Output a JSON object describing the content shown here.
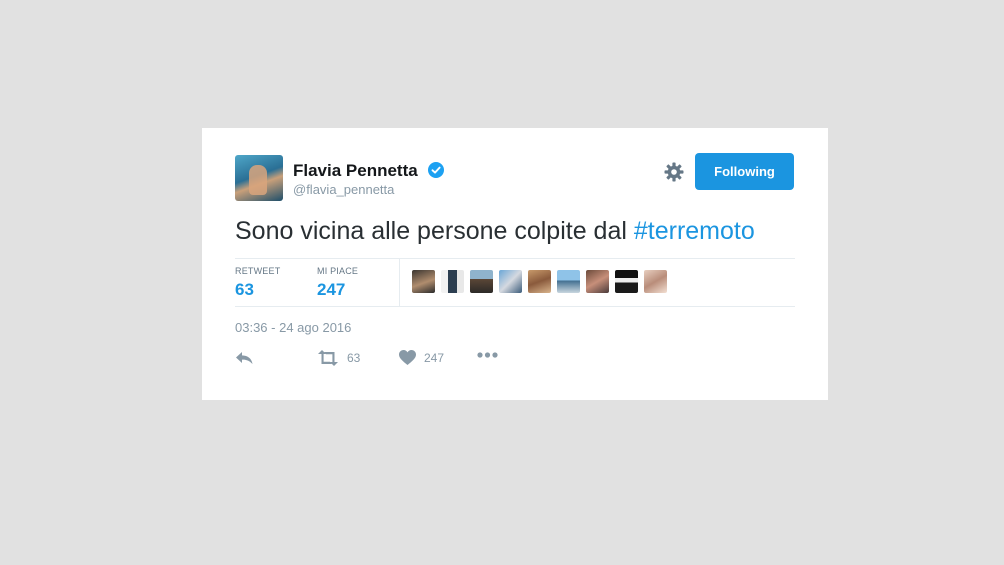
{
  "tweet": {
    "author": {
      "name": "Flavia Pennetta",
      "handle": "@flavia_pennetta",
      "verified": true
    },
    "follow_button": "Following",
    "text_plain": "Sono vicina alle persone colpite dal ",
    "hashtag": "#terremoto",
    "stats": {
      "retweet_label": "RETWEET",
      "retweet_count": "63",
      "likes_label": "MI PIACE",
      "likes_count": "247"
    },
    "facepile_count": 9,
    "timestamp": "03:36 - 24 ago 2016",
    "actions": {
      "reply_icon": "reply-icon",
      "retweet_icon": "retweet-icon",
      "retweet_count": "63",
      "like_icon": "heart-icon",
      "like_count": "247",
      "more_icon": "more-icon"
    }
  },
  "colors": {
    "accent": "#1b95e0",
    "text": "#14171a",
    "muted": "#8899a6",
    "background": "#e1e1e1"
  }
}
